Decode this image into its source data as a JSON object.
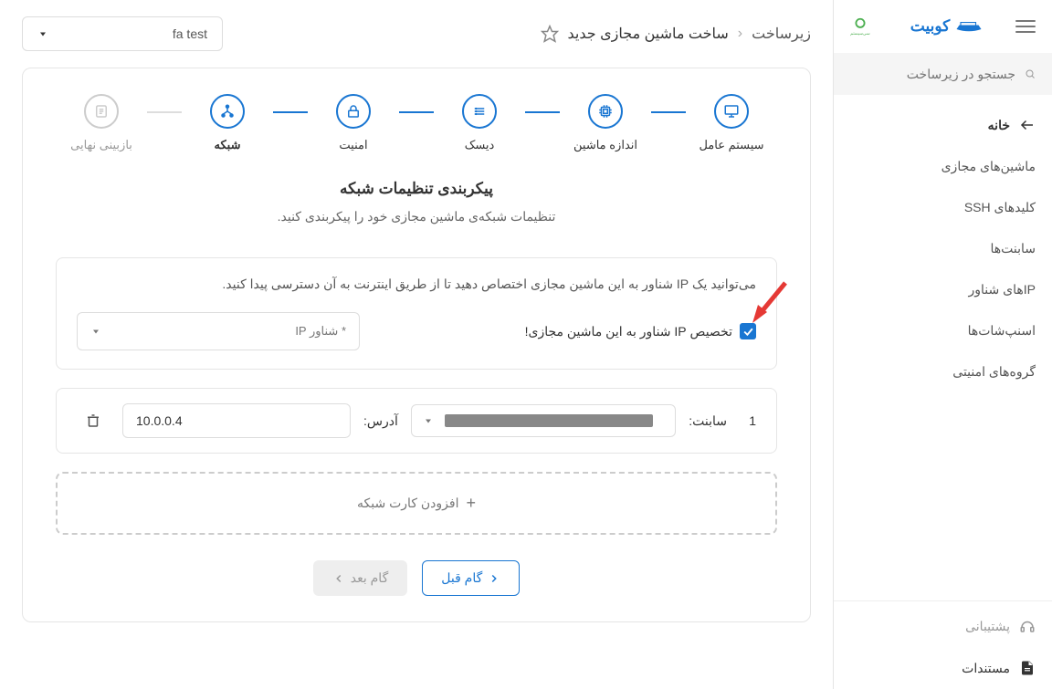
{
  "brand": "کوبیت",
  "search": {
    "placeholder": "جستجو در زیرساخت"
  },
  "nav": {
    "home": "خانه",
    "vms": "ماشین‌های مجازی",
    "ssh": "کلیدهای SSH",
    "subnets": "سابنت‌ها",
    "floatingips": "IPهای شناور",
    "snapshots": "اسنپ‌شات‌ها",
    "secgroups": "گروه‌های امنیتی",
    "support": "پشتیبانی",
    "docs": "مستندات"
  },
  "breadcrumb": {
    "root": "زیرساخت",
    "current": "ساخت ماشین مجازی جدید"
  },
  "project": "fa test",
  "steps": {
    "os": "سیستم عامل",
    "size": "اندازه ماشین",
    "disk": "دیسک",
    "security": "امنیت",
    "network": "شبکه",
    "review": "بازبینی نهایی"
  },
  "page_title": "پیکربندی تنظیمات شبکه",
  "page_desc": "تنظیمات شبکه‌ی ماشین مجازی خود را پیکربندی کنید.",
  "floating_panel": {
    "desc": "می‌توانید یک IP شناور به این ماشین مجازی اختصاص دهید تا از طریق اینترنت به آن دسترسی پیدا کنید.",
    "check_label": "تخصیص IP شناور به این ماشین مجازی!",
    "select_placeholder": "IP شناور *"
  },
  "subnet_row": {
    "num": "1",
    "subnet_label": "سابنت:",
    "addr_label": "آدرس:",
    "addr_value": "10.0.0.4"
  },
  "add_network": "افزودن کارت شبکه",
  "buttons": {
    "prev": "گام قبل",
    "next": "گام بعد"
  }
}
